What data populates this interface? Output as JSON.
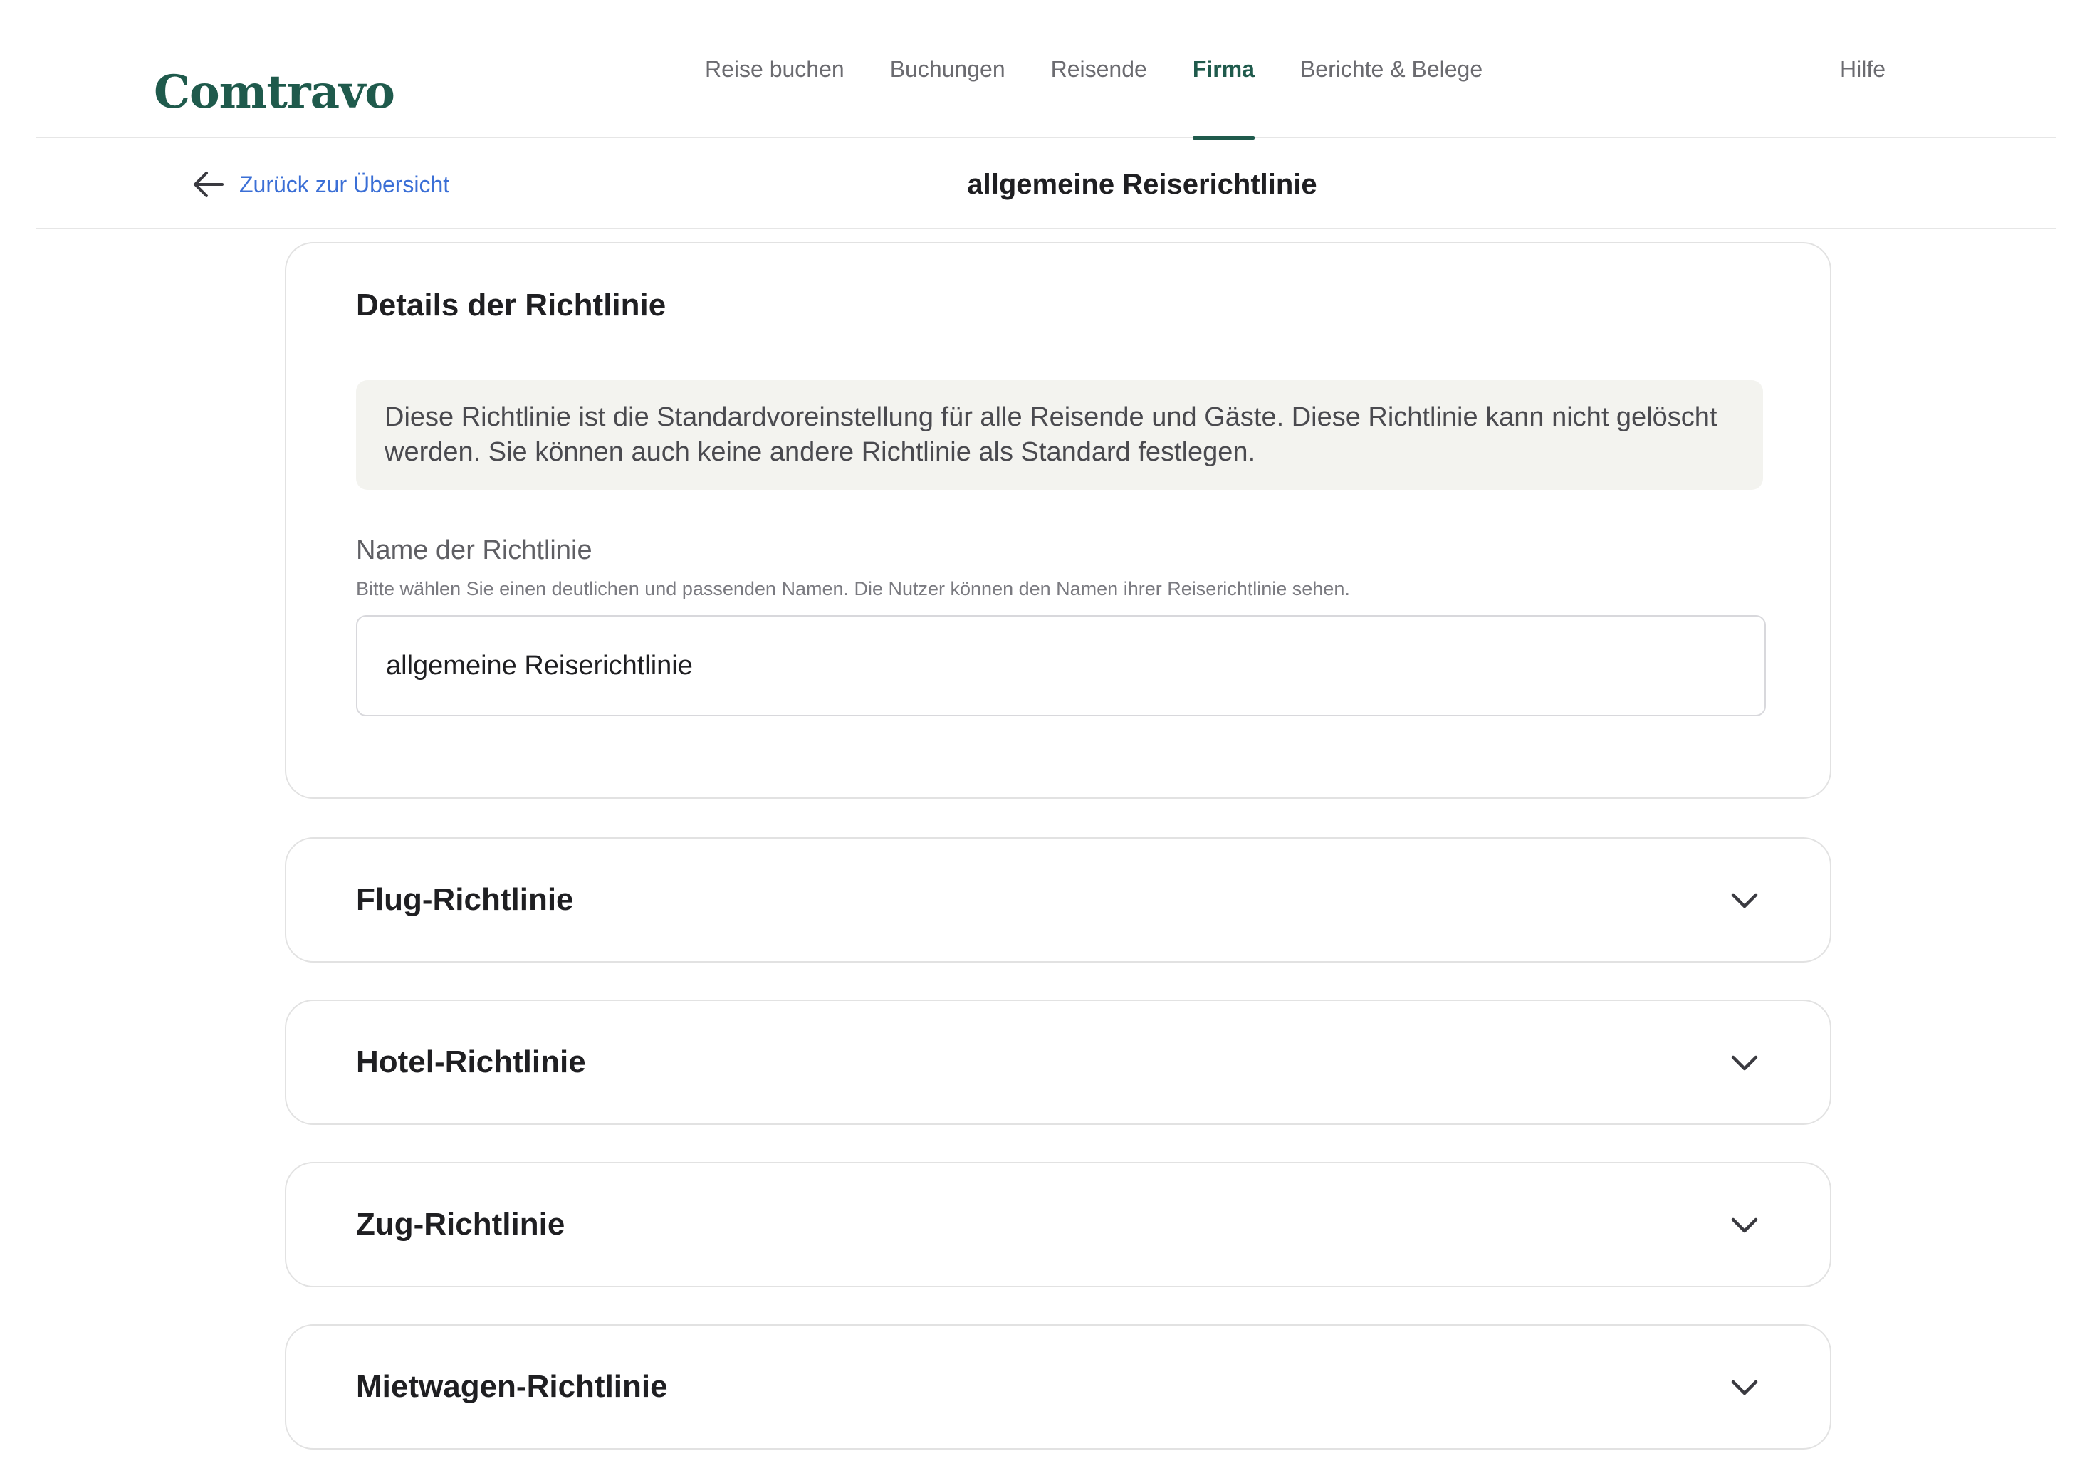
{
  "brand": {
    "logo_text": "Comtravo",
    "accent_color": "#1f5a4c",
    "link_color": "#3b6fd6"
  },
  "nav": {
    "items": [
      {
        "label": "Reise buchen",
        "active": false
      },
      {
        "label": "Buchungen",
        "active": false
      },
      {
        "label": "Reisende",
        "active": false
      },
      {
        "label": "Firma",
        "active": true
      },
      {
        "label": "Berichte & Belege",
        "active": false
      }
    ],
    "help_label": "Hilfe"
  },
  "subheader": {
    "back_label": "Zurück zur Übersicht",
    "back_icon": "arrow-left-icon",
    "title": "allgemeine Reiserichtlinie"
  },
  "details": {
    "title": "Details der Richtlinie",
    "info_text": "Diese Richtlinie ist die Standardvoreinstellung für alle Reisende und Gäste. Diese Richtlinie kann nicht gelöscht werden. Sie können auch keine andere Richtlinie als Standard festlegen.",
    "name_label": "Name der Richtlinie",
    "name_hint": "Bitte wählen Sie einen deutlichen und passenden Namen. Die Nutzer können den Namen ihrer Reiserichtlinie sehen.",
    "name_value": "allgemeine Reiserichtlinie"
  },
  "sections": [
    {
      "title": "Flug-Richtlinie",
      "icon": "chevron-down-icon"
    },
    {
      "title": "Hotel-Richtlinie",
      "icon": "chevron-down-icon"
    },
    {
      "title": "Zug-Richtlinie",
      "icon": "chevron-down-icon"
    },
    {
      "title": "Mietwagen-Richtlinie",
      "icon": "chevron-down-icon"
    }
  ]
}
